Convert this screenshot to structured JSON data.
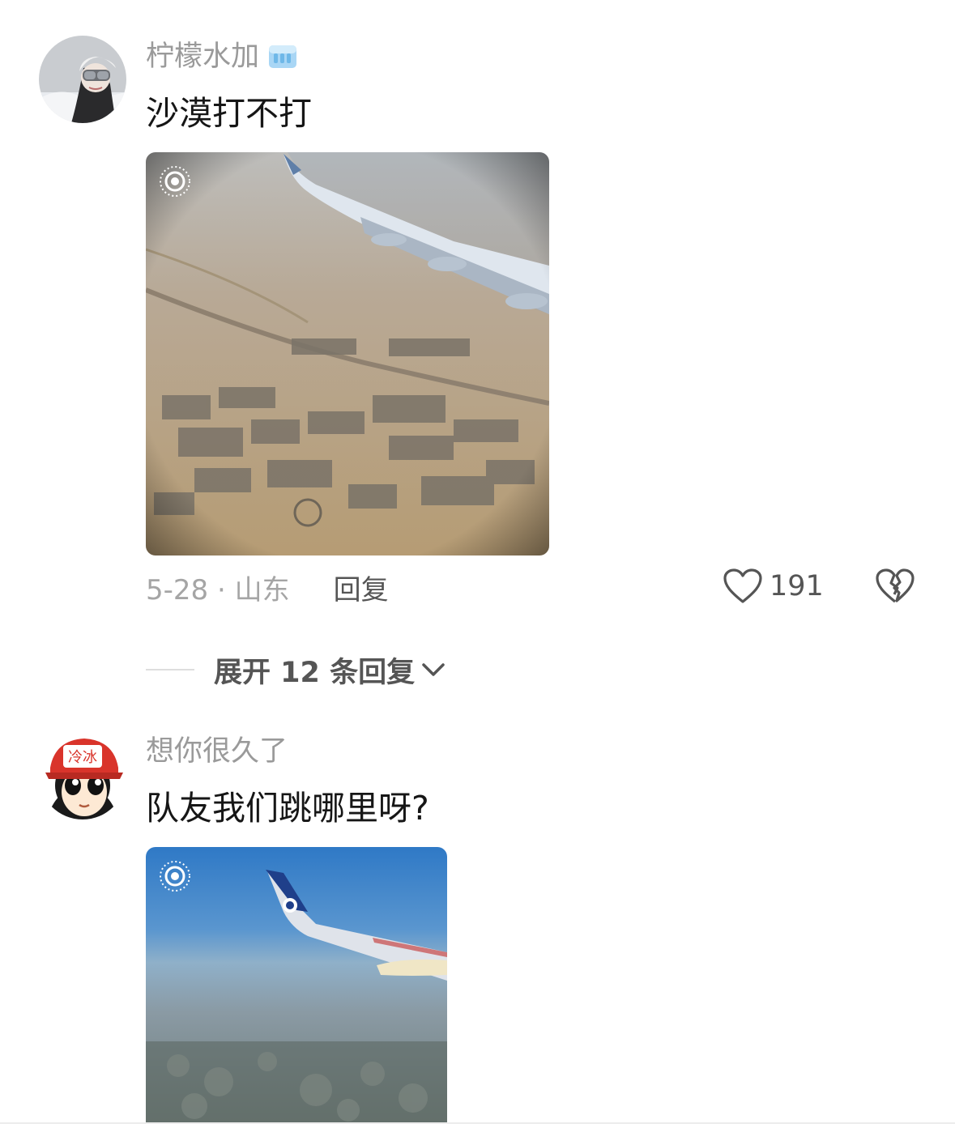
{
  "comments": [
    {
      "username": "柠檬水加",
      "badge_icon": "ice-cube-icon",
      "text": "沙漠打不打",
      "photo_description": "desert-city-from-airplane-window",
      "live_icon": "live-photo-icon",
      "date_location": "5-28 · 山东",
      "reply_label": "回复",
      "like_icon": "heart-outline-icon",
      "like_count": "191",
      "dislike_icon": "broken-heart-icon",
      "expand_label": "展开 12 条回复",
      "expand_icon": "chevron-down-icon"
    },
    {
      "username": "想你很久了",
      "avatar_text": "冷冰",
      "text": "队友我们跳哪里呀?",
      "photo_description": "sky-over-city-from-airplane-window",
      "live_icon": "live-photo-icon"
    }
  ],
  "colors": {
    "username": "#9a9a9a",
    "text": "#161616",
    "secondary": "#555555",
    "muted": "#a5a5a5",
    "cap_red": "#d9342b"
  }
}
